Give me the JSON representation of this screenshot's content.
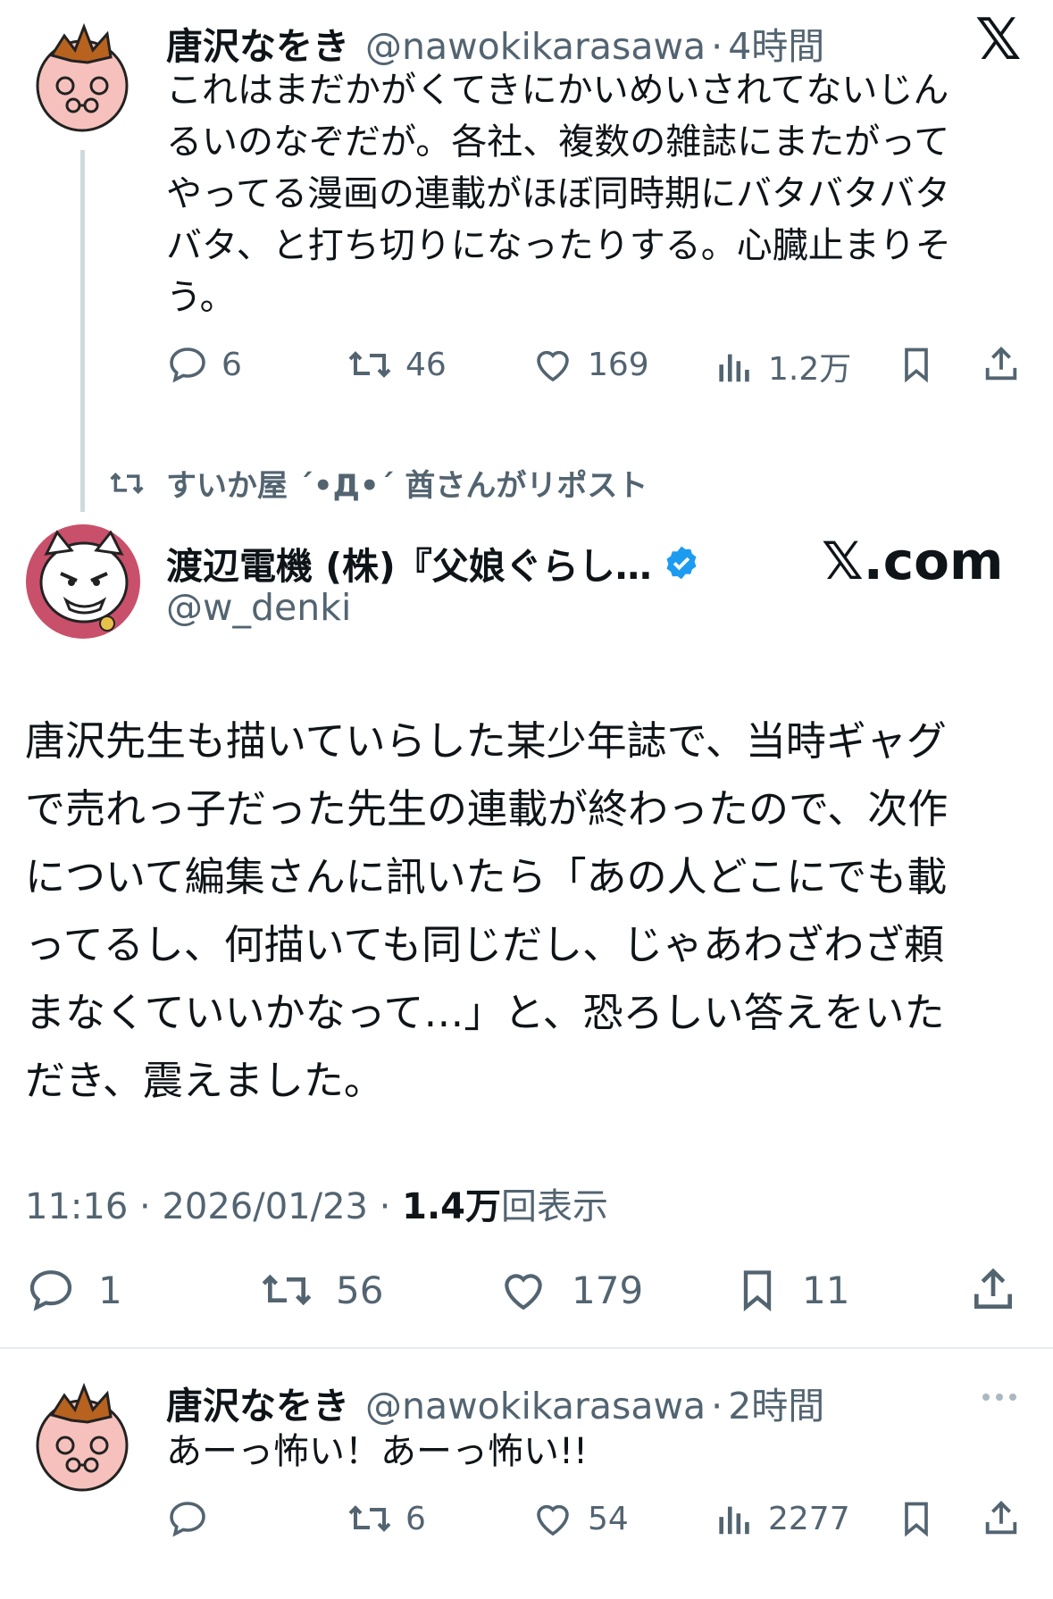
{
  "tweet1": {
    "name": "唐沢なをき",
    "handle": "@nawokikarasawa",
    "sep": "·",
    "time": "4時間",
    "lines": [
      "これはまだかがくてきにかいめいされてないじん",
      "るいのなぞだが。各社、複数の雑誌にまたがって",
      "やってる漫画の連載がほぼ同時期にバタバタバタ",
      "バタ、と打ち切りになったりする。心臓止まりそ",
      "う。"
    ],
    "replies": "6",
    "reposts": "46",
    "likes": "169",
    "views": "1.2万"
  },
  "repost_notice": "すいか屋 ´•Д•´ 酋さんがリポスト",
  "tweet2": {
    "name": "渡辺電機 (株)『父娘ぐらし…",
    "handle": "@w_denki",
    "lines": [
      "唐沢先生も描いていらした某少年誌で、当時ギャグ",
      "で売れっ子だった先生の連載が終わったので、次作",
      "について編集さんに訊いたら「あの人どこにでも載",
      "ってるし、何描いても同じだし、じゃあわざわざ頼",
      "まなくていいかなって…」と、恐ろしい答えをいた",
      "だき、震えました。"
    ],
    "time": "11:16 · 2026/01/23 · ",
    "views_count": "1.4万",
    "views_label": "回表示",
    "replies": "1",
    "reposts": "56",
    "likes": "179",
    "bookmarks": "11"
  },
  "tweet3": {
    "name": "唐沢なをき",
    "handle": "@nawokikarasawa",
    "sep": "·",
    "time": "2時間",
    "text": "あーっ怖い！あーっ怖い!!",
    "replies": "",
    "reposts": "6",
    "likes": "54",
    "views": "2277"
  },
  "overlay": {
    "x_logo": "𝕏",
    "xcom": "𝕏.com"
  },
  "colors": {
    "text": "#0f1419",
    "muted": "#536471",
    "verified": "#1d9bf0"
  }
}
